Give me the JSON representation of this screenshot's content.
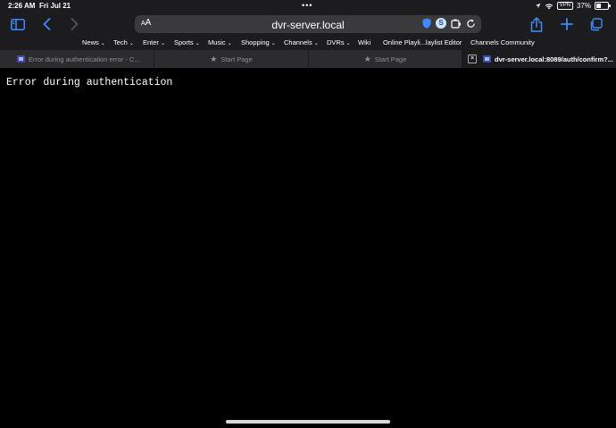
{
  "status_bar": {
    "time": "2:26 AM",
    "date": "Fri Jul 21",
    "vpn": "VPN",
    "battery": "37%"
  },
  "toolbar": {
    "text_size_label": "AA",
    "url": "dvr-server.local",
    "extension_badge": "S"
  },
  "bookmarks": [
    {
      "label": "News",
      "has_menu": true
    },
    {
      "label": "Tech",
      "has_menu": true
    },
    {
      "label": "Enter",
      "has_menu": true
    },
    {
      "label": "Sports",
      "has_menu": true
    },
    {
      "label": "Music",
      "has_menu": true
    },
    {
      "label": "Shopping",
      "has_menu": true
    },
    {
      "label": "Channels",
      "has_menu": true
    },
    {
      "label": "DVRs",
      "has_menu": true
    },
    {
      "label": "Wiki",
      "has_menu": false
    },
    {
      "label": "Online Playli...laylist Editor",
      "has_menu": false
    },
    {
      "label": "Channels Community",
      "has_menu": false
    }
  ],
  "tabs": [
    {
      "label": "Error during authentication error - C...",
      "icon": "favicon",
      "active": false
    },
    {
      "label": "Start Page",
      "icon": "star-icon",
      "active": false
    },
    {
      "label": "Start Page",
      "icon": "star-icon",
      "active": false
    },
    {
      "label": "dvr-server.local:8089/auth/confirm?...",
      "icon": "favicon",
      "active": true
    }
  ],
  "page": {
    "message": "Error during authentication"
  },
  "colors": {
    "accent": "#3b8cff",
    "toolbar_bg": "#1c1c1e",
    "address_bg": "#3a3a3c",
    "page_bg": "#000000"
  }
}
